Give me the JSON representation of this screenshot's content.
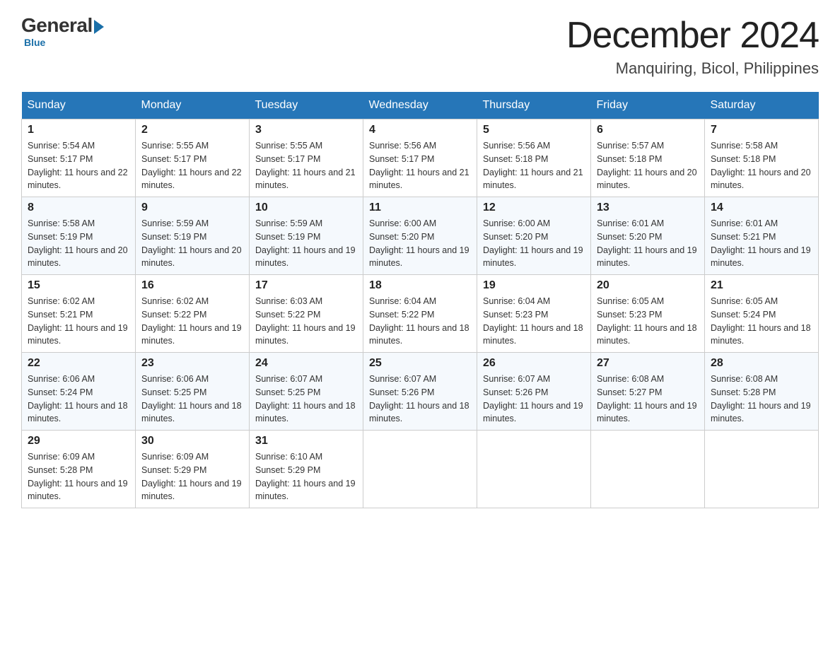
{
  "logo": {
    "general": "General",
    "blue": "Blue"
  },
  "title": {
    "month_year": "December 2024",
    "location": "Manquiring, Bicol, Philippines"
  },
  "days_header": [
    "Sunday",
    "Monday",
    "Tuesday",
    "Wednesday",
    "Thursday",
    "Friday",
    "Saturday"
  ],
  "weeks": [
    [
      {
        "day": "1",
        "sunrise": "5:54 AM",
        "sunset": "5:17 PM",
        "daylight": "11 hours and 22 minutes."
      },
      {
        "day": "2",
        "sunrise": "5:55 AM",
        "sunset": "5:17 PM",
        "daylight": "11 hours and 22 minutes."
      },
      {
        "day": "3",
        "sunrise": "5:55 AM",
        "sunset": "5:17 PM",
        "daylight": "11 hours and 21 minutes."
      },
      {
        "day": "4",
        "sunrise": "5:56 AM",
        "sunset": "5:17 PM",
        "daylight": "11 hours and 21 minutes."
      },
      {
        "day": "5",
        "sunrise": "5:56 AM",
        "sunset": "5:18 PM",
        "daylight": "11 hours and 21 minutes."
      },
      {
        "day": "6",
        "sunrise": "5:57 AM",
        "sunset": "5:18 PM",
        "daylight": "11 hours and 20 minutes."
      },
      {
        "day": "7",
        "sunrise": "5:58 AM",
        "sunset": "5:18 PM",
        "daylight": "11 hours and 20 minutes."
      }
    ],
    [
      {
        "day": "8",
        "sunrise": "5:58 AM",
        "sunset": "5:19 PM",
        "daylight": "11 hours and 20 minutes."
      },
      {
        "day": "9",
        "sunrise": "5:59 AM",
        "sunset": "5:19 PM",
        "daylight": "11 hours and 20 minutes."
      },
      {
        "day": "10",
        "sunrise": "5:59 AM",
        "sunset": "5:19 PM",
        "daylight": "11 hours and 19 minutes."
      },
      {
        "day": "11",
        "sunrise": "6:00 AM",
        "sunset": "5:20 PM",
        "daylight": "11 hours and 19 minutes."
      },
      {
        "day": "12",
        "sunrise": "6:00 AM",
        "sunset": "5:20 PM",
        "daylight": "11 hours and 19 minutes."
      },
      {
        "day": "13",
        "sunrise": "6:01 AM",
        "sunset": "5:20 PM",
        "daylight": "11 hours and 19 minutes."
      },
      {
        "day": "14",
        "sunrise": "6:01 AM",
        "sunset": "5:21 PM",
        "daylight": "11 hours and 19 minutes."
      }
    ],
    [
      {
        "day": "15",
        "sunrise": "6:02 AM",
        "sunset": "5:21 PM",
        "daylight": "11 hours and 19 minutes."
      },
      {
        "day": "16",
        "sunrise": "6:02 AM",
        "sunset": "5:22 PM",
        "daylight": "11 hours and 19 minutes."
      },
      {
        "day": "17",
        "sunrise": "6:03 AM",
        "sunset": "5:22 PM",
        "daylight": "11 hours and 19 minutes."
      },
      {
        "day": "18",
        "sunrise": "6:04 AM",
        "sunset": "5:22 PM",
        "daylight": "11 hours and 18 minutes."
      },
      {
        "day": "19",
        "sunrise": "6:04 AM",
        "sunset": "5:23 PM",
        "daylight": "11 hours and 18 minutes."
      },
      {
        "day": "20",
        "sunrise": "6:05 AM",
        "sunset": "5:23 PM",
        "daylight": "11 hours and 18 minutes."
      },
      {
        "day": "21",
        "sunrise": "6:05 AM",
        "sunset": "5:24 PM",
        "daylight": "11 hours and 18 minutes."
      }
    ],
    [
      {
        "day": "22",
        "sunrise": "6:06 AM",
        "sunset": "5:24 PM",
        "daylight": "11 hours and 18 minutes."
      },
      {
        "day": "23",
        "sunrise": "6:06 AM",
        "sunset": "5:25 PM",
        "daylight": "11 hours and 18 minutes."
      },
      {
        "day": "24",
        "sunrise": "6:07 AM",
        "sunset": "5:25 PM",
        "daylight": "11 hours and 18 minutes."
      },
      {
        "day": "25",
        "sunrise": "6:07 AM",
        "sunset": "5:26 PM",
        "daylight": "11 hours and 18 minutes."
      },
      {
        "day": "26",
        "sunrise": "6:07 AM",
        "sunset": "5:26 PM",
        "daylight": "11 hours and 19 minutes."
      },
      {
        "day": "27",
        "sunrise": "6:08 AM",
        "sunset": "5:27 PM",
        "daylight": "11 hours and 19 minutes."
      },
      {
        "day": "28",
        "sunrise": "6:08 AM",
        "sunset": "5:28 PM",
        "daylight": "11 hours and 19 minutes."
      }
    ],
    [
      {
        "day": "29",
        "sunrise": "6:09 AM",
        "sunset": "5:28 PM",
        "daylight": "11 hours and 19 minutes."
      },
      {
        "day": "30",
        "sunrise": "6:09 AM",
        "sunset": "5:29 PM",
        "daylight": "11 hours and 19 minutes."
      },
      {
        "day": "31",
        "sunrise": "6:10 AM",
        "sunset": "5:29 PM",
        "daylight": "11 hours and 19 minutes."
      },
      null,
      null,
      null,
      null
    ]
  ],
  "labels": {
    "sunrise": "Sunrise:",
    "sunset": "Sunset:",
    "daylight": "Daylight:"
  }
}
